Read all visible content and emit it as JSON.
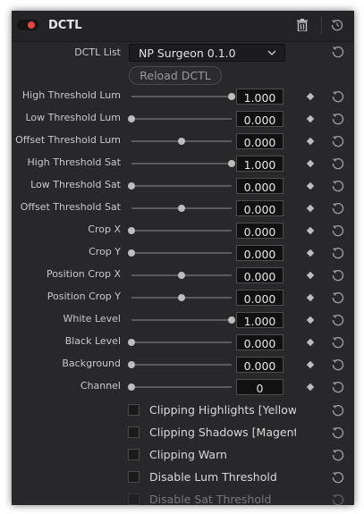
{
  "header": {
    "title": "DCTL",
    "enabled": true
  },
  "dctl_list": {
    "label": "DCTL List",
    "value": "NP Surgeon 0.1.0"
  },
  "reload_button": "Reload DCTL",
  "sliders": [
    {
      "label": "High Threshold Lum",
      "value": "1.000",
      "level": 1.0
    },
    {
      "label": "Low Threshold Lum",
      "value": "0.000",
      "level": 0.0
    },
    {
      "label": "Offset Threshold Lum",
      "value": "0.000",
      "level": 0.5
    },
    {
      "label": "High Threshold Sat",
      "value": "1.000",
      "level": 1.0
    },
    {
      "label": "Low Threshold Sat",
      "value": "0.000",
      "level": 0.0
    },
    {
      "label": "Offset Threshold Sat",
      "value": "0.000",
      "level": 0.5
    },
    {
      "label": "Crop X",
      "value": "0.000",
      "level": 0.0
    },
    {
      "label": "Crop Y",
      "value": "0.000",
      "level": 0.0
    },
    {
      "label": "Position Crop X",
      "value": "0.000",
      "level": 0.5
    },
    {
      "label": "Position Crop Y",
      "value": "0.000",
      "level": 0.5
    },
    {
      "label": "White Level",
      "value": "1.000",
      "level": 1.0
    },
    {
      "label": "Black Level",
      "value": "0.000",
      "level": 0.0
    },
    {
      "label": "Background",
      "value": "0.000",
      "level": 0.0
    },
    {
      "label": "Channel",
      "value": "0",
      "level": 0.0
    }
  ],
  "checkboxes": [
    {
      "label": "Clipping Highlights [Yellow]",
      "checked": false
    },
    {
      "label": "Clipping Shadows [Magenta]",
      "checked": false
    },
    {
      "label": "Clipping Warn",
      "checked": false
    },
    {
      "label": "Disable Lum Threshold",
      "checked": false
    },
    {
      "label": "Disable Sat Threshold",
      "checked": false
    }
  ],
  "colors": {
    "toggle_on": "#e8433d",
    "panel_bg": "#28282a",
    "field_bg": "#111112"
  },
  "icons": {
    "delete": "trash-icon",
    "reset": "reset-icon",
    "keyframe": "keyframe-diamond-icon",
    "dropdown": "chevron-down-icon"
  }
}
